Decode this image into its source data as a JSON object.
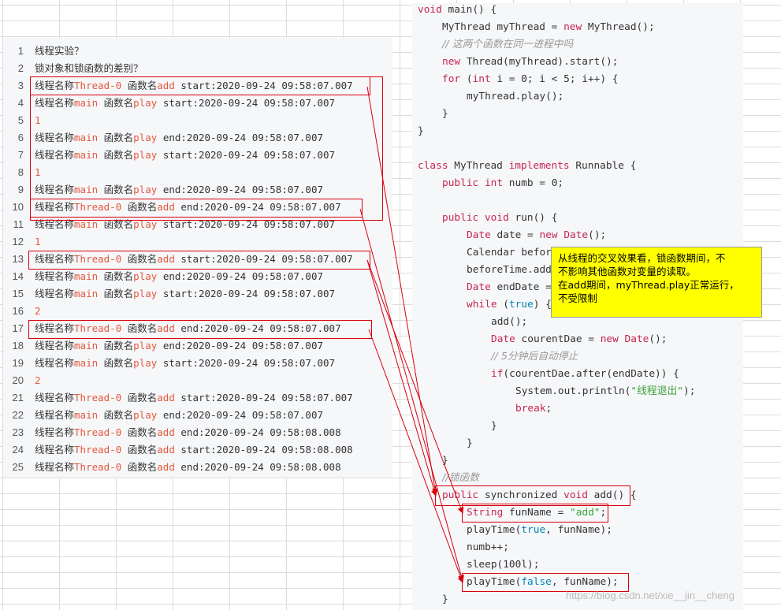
{
  "log": {
    "rows": [
      {
        "n": "1",
        "kind": "note",
        "text": "线程实验？"
      },
      {
        "n": "2",
        "kind": "note",
        "text": "锁对象和锁函数的差别？"
      },
      {
        "n": "3",
        "kind": "log",
        "thread": "Thread-0",
        "fn": "add",
        "phase": "start",
        "time": "2020-09-24 09:58:07.007"
      },
      {
        "n": "4",
        "kind": "log",
        "thread": "main",
        "fn": "play",
        "phase": "start",
        "time": "2020-09-24 09:58:07.007"
      },
      {
        "n": "5",
        "kind": "num",
        "text": "1"
      },
      {
        "n": "6",
        "kind": "log",
        "thread": "main",
        "fn": "play",
        "phase": "end",
        "time": "2020-09-24 09:58:07.007"
      },
      {
        "n": "7",
        "kind": "log",
        "thread": "main",
        "fn": "play",
        "phase": "start",
        "time": "2020-09-24 09:58:07.007"
      },
      {
        "n": "8",
        "kind": "num",
        "text": "1"
      },
      {
        "n": "9",
        "kind": "log",
        "thread": "main",
        "fn": "play",
        "phase": "end",
        "time": "2020-09-24 09:58:07.007"
      },
      {
        "n": "10",
        "kind": "log",
        "thread": "Thread-0",
        "fn": "add",
        "phase": "end",
        "time": "2020-09-24 09:58:07.007"
      },
      {
        "n": "11",
        "kind": "log",
        "thread": "main",
        "fn": "play",
        "phase": "start",
        "time": "2020-09-24 09:58:07.007"
      },
      {
        "n": "12",
        "kind": "num",
        "text": "1"
      },
      {
        "n": "13",
        "kind": "log",
        "thread": "Thread-0",
        "fn": "add",
        "phase": "start",
        "time": "2020-09-24 09:58:07.007"
      },
      {
        "n": "14",
        "kind": "log",
        "thread": "main",
        "fn": "play",
        "phase": "end",
        "time": "2020-09-24 09:58:07.007"
      },
      {
        "n": "15",
        "kind": "log",
        "thread": "main",
        "fn": "play",
        "phase": "start",
        "time": "2020-09-24 09:58:07.007"
      },
      {
        "n": "16",
        "kind": "num",
        "text": "2"
      },
      {
        "n": "17",
        "kind": "log",
        "thread": "Thread-0",
        "fn": "add",
        "phase": "end",
        "time": "2020-09-24 09:58:07.007"
      },
      {
        "n": "18",
        "kind": "log",
        "thread": "main",
        "fn": "play",
        "phase": "end",
        "time": "2020-09-24 09:58:07.007"
      },
      {
        "n": "19",
        "kind": "log",
        "thread": "main",
        "fn": "play",
        "phase": "start",
        "time": "2020-09-24 09:58:07.007"
      },
      {
        "n": "20",
        "kind": "num",
        "text": "2"
      },
      {
        "n": "21",
        "kind": "log",
        "thread": "Thread-0",
        "fn": "add",
        "phase": "start",
        "time": "2020-09-24 09:58:07.007"
      },
      {
        "n": "22",
        "kind": "log",
        "thread": "main",
        "fn": "play",
        "phase": "end",
        "time": "2020-09-24 09:58:07.007"
      },
      {
        "n": "23",
        "kind": "log",
        "thread": "Thread-0",
        "fn": "add",
        "phase": "end",
        "time": "2020-09-24 09:58:08.008"
      },
      {
        "n": "24",
        "kind": "log",
        "thread": "Thread-0",
        "fn": "add",
        "phase": "start",
        "time": "2020-09-24 09:58:08.008"
      },
      {
        "n": "25",
        "kind": "log",
        "thread": "Thread-0",
        "fn": "add",
        "phase": "end",
        "time": "2020-09-24 09:58:08.008"
      }
    ],
    "label_thread": "线程名称",
    "label_fn": "函数名"
  },
  "code": {
    "lines": [
      {
        "indent": 0,
        "tokens": [
          [
            "k",
            "void"
          ],
          [
            "cn",
            " main() {"
          ]
        ]
      },
      {
        "indent": 1,
        "tokens": [
          [
            "cn",
            "MyThread myThread = "
          ],
          [
            "k",
            "new"
          ],
          [
            "cn",
            " MyThread();"
          ]
        ]
      },
      {
        "indent": 1,
        "tokens": [
          [
            "c",
            "// 这两个函数在同一进程中吗"
          ]
        ]
      },
      {
        "indent": 1,
        "tokens": [
          [
            "k",
            "new"
          ],
          [
            "cn",
            " Thread(myThread).start();"
          ]
        ]
      },
      {
        "indent": 1,
        "tokens": [
          [
            "k",
            "for"
          ],
          [
            "cn",
            " ("
          ],
          [
            "k",
            "int"
          ],
          [
            "cn",
            " i = 0; i < 5; i++) {"
          ]
        ]
      },
      {
        "indent": 2,
        "tokens": [
          [
            "cn",
            "myThread.play();"
          ]
        ]
      },
      {
        "indent": 1,
        "tokens": [
          [
            "cn",
            "}"
          ]
        ]
      },
      {
        "indent": 0,
        "tokens": [
          [
            "cn",
            "}"
          ]
        ]
      },
      {
        "indent": 0,
        "tokens": [
          [
            "cn",
            ""
          ]
        ]
      },
      {
        "indent": 0,
        "tokens": [
          [
            "k",
            "class"
          ],
          [
            "cn",
            " MyThread "
          ],
          [
            "k",
            "implements"
          ],
          [
            "cn",
            " Runnable {"
          ]
        ]
      },
      {
        "indent": 1,
        "tokens": [
          [
            "k",
            "public"
          ],
          [
            "cn",
            " "
          ],
          [
            "k",
            "int"
          ],
          [
            "cn",
            " numb = 0;"
          ]
        ]
      },
      {
        "indent": 0,
        "tokens": [
          [
            "cn",
            ""
          ]
        ]
      },
      {
        "indent": 1,
        "tokens": [
          [
            "k",
            "public"
          ],
          [
            "cn",
            " "
          ],
          [
            "k",
            "void"
          ],
          [
            "cn",
            " run() {"
          ]
        ]
      },
      {
        "indent": 2,
        "tokens": [
          [
            "k",
            "Date"
          ],
          [
            "cn",
            " date = "
          ],
          [
            "k",
            "new"
          ],
          [
            "cn",
            " "
          ],
          [
            "k",
            "Date"
          ],
          [
            "cn",
            "();"
          ]
        ]
      },
      {
        "indent": 2,
        "tokens": [
          [
            "cn",
            "Calendar befor"
          ]
        ]
      },
      {
        "indent": 2,
        "tokens": [
          [
            "cn",
            "beforeTime.add"
          ]
        ]
      },
      {
        "indent": 2,
        "tokens": [
          [
            "k",
            "Date"
          ],
          [
            "cn",
            " endDate ="
          ]
        ]
      },
      {
        "indent": 2,
        "tokens": [
          [
            "k",
            "while"
          ],
          [
            "cn",
            " ("
          ],
          [
            "b",
            "true"
          ],
          [
            "cn",
            ") {"
          ]
        ]
      },
      {
        "indent": 3,
        "tokens": [
          [
            "cn",
            "add();"
          ]
        ]
      },
      {
        "indent": 3,
        "tokens": [
          [
            "k",
            "Date"
          ],
          [
            "cn",
            " courentDae = "
          ],
          [
            "k",
            "new"
          ],
          [
            "cn",
            " "
          ],
          [
            "k",
            "Date"
          ],
          [
            "cn",
            "();"
          ]
        ]
      },
      {
        "indent": 3,
        "tokens": [
          [
            "c",
            "// 5分钟后自动停止"
          ]
        ]
      },
      {
        "indent": 3,
        "tokens": [
          [
            "k",
            "if"
          ],
          [
            "cn",
            "(courentDae.after(endDate)) {"
          ]
        ]
      },
      {
        "indent": 4,
        "tokens": [
          [
            "cn",
            "System.out.println("
          ],
          [
            "s",
            "\"线程退出\""
          ],
          [
            "cn",
            ");"
          ]
        ]
      },
      {
        "indent": 4,
        "tokens": [
          [
            "k",
            "break"
          ],
          [
            "cn",
            ";"
          ]
        ]
      },
      {
        "indent": 3,
        "tokens": [
          [
            "cn",
            "}"
          ]
        ]
      },
      {
        "indent": 2,
        "tokens": [
          [
            "cn",
            "}"
          ]
        ]
      },
      {
        "indent": 1,
        "tokens": [
          [
            "cn",
            "}"
          ]
        ]
      },
      {
        "indent": 1,
        "tokens": [
          [
            "c",
            "//锁函数"
          ]
        ]
      },
      {
        "indent": 1,
        "tokens": [
          [
            "k",
            "public"
          ],
          [
            "cn",
            " synchronized "
          ],
          [
            "k",
            "void"
          ],
          [
            "cn",
            " add() {"
          ]
        ]
      },
      {
        "indent": 2,
        "tokens": [
          [
            "k",
            "String"
          ],
          [
            "cn",
            " funName = "
          ],
          [
            "s",
            "\"add\""
          ],
          [
            "cn",
            ";"
          ]
        ]
      },
      {
        "indent": 2,
        "tokens": [
          [
            "cn",
            "playTime("
          ],
          [
            "b",
            "true"
          ],
          [
            "cn",
            ", funName);"
          ]
        ]
      },
      {
        "indent": 2,
        "tokens": [
          [
            "cn",
            "numb++;"
          ]
        ]
      },
      {
        "indent": 2,
        "tokens": [
          [
            "cn",
            "sleep(100l);"
          ]
        ]
      },
      {
        "indent": 2,
        "tokens": [
          [
            "cn",
            "playTime("
          ],
          [
            "b",
            "false"
          ],
          [
            "cn",
            ", funName);"
          ]
        ]
      },
      {
        "indent": 1,
        "tokens": [
          [
            "cn",
            "}"
          ]
        ]
      }
    ]
  },
  "note": {
    "lines": [
      "从线程的交叉效果看，锁函数期间，不",
      "不影响其他函数对变量的读取。",
      "在add期间，myThread.play正常运行，",
      "不受限制"
    ]
  },
  "watermark": "https://blog.csdn.net/xie__jin__cheng",
  "colors": {
    "keyword": "#e4593d",
    "highlight": "#d8000c",
    "note_bg": "#ffff00",
    "panel_bg": "#f6f7f9"
  }
}
